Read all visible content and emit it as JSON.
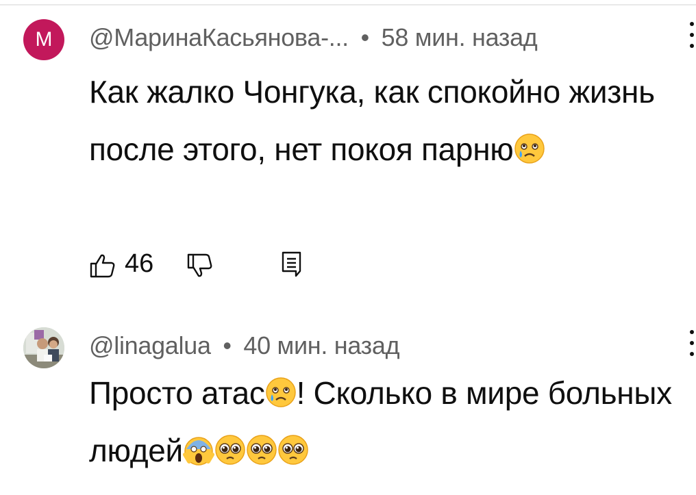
{
  "comments": [
    {
      "avatar_letter": "M",
      "author": "@МаринаКасьянова-...",
      "separator": "•",
      "time": "58 мин. назад",
      "text_before": "Как жалко Чонгука, как спокойно жизнь после этого, нет покоя парню",
      "emojis": [
        "crying-face"
      ],
      "likes": "46"
    },
    {
      "author": "@linagalua",
      "separator": "•",
      "time": "40 мин. назад",
      "text_before": "Просто атас",
      "text_after": "! Сколько в мире больных людей",
      "emojis": [
        "crying-face",
        "screaming-face",
        "pleading-face",
        "pleading-face",
        "pleading-face"
      ]
    }
  ],
  "colors": {
    "avatar_m": "#c2185b",
    "meta": "#606060",
    "text": "#0f0f0f"
  }
}
